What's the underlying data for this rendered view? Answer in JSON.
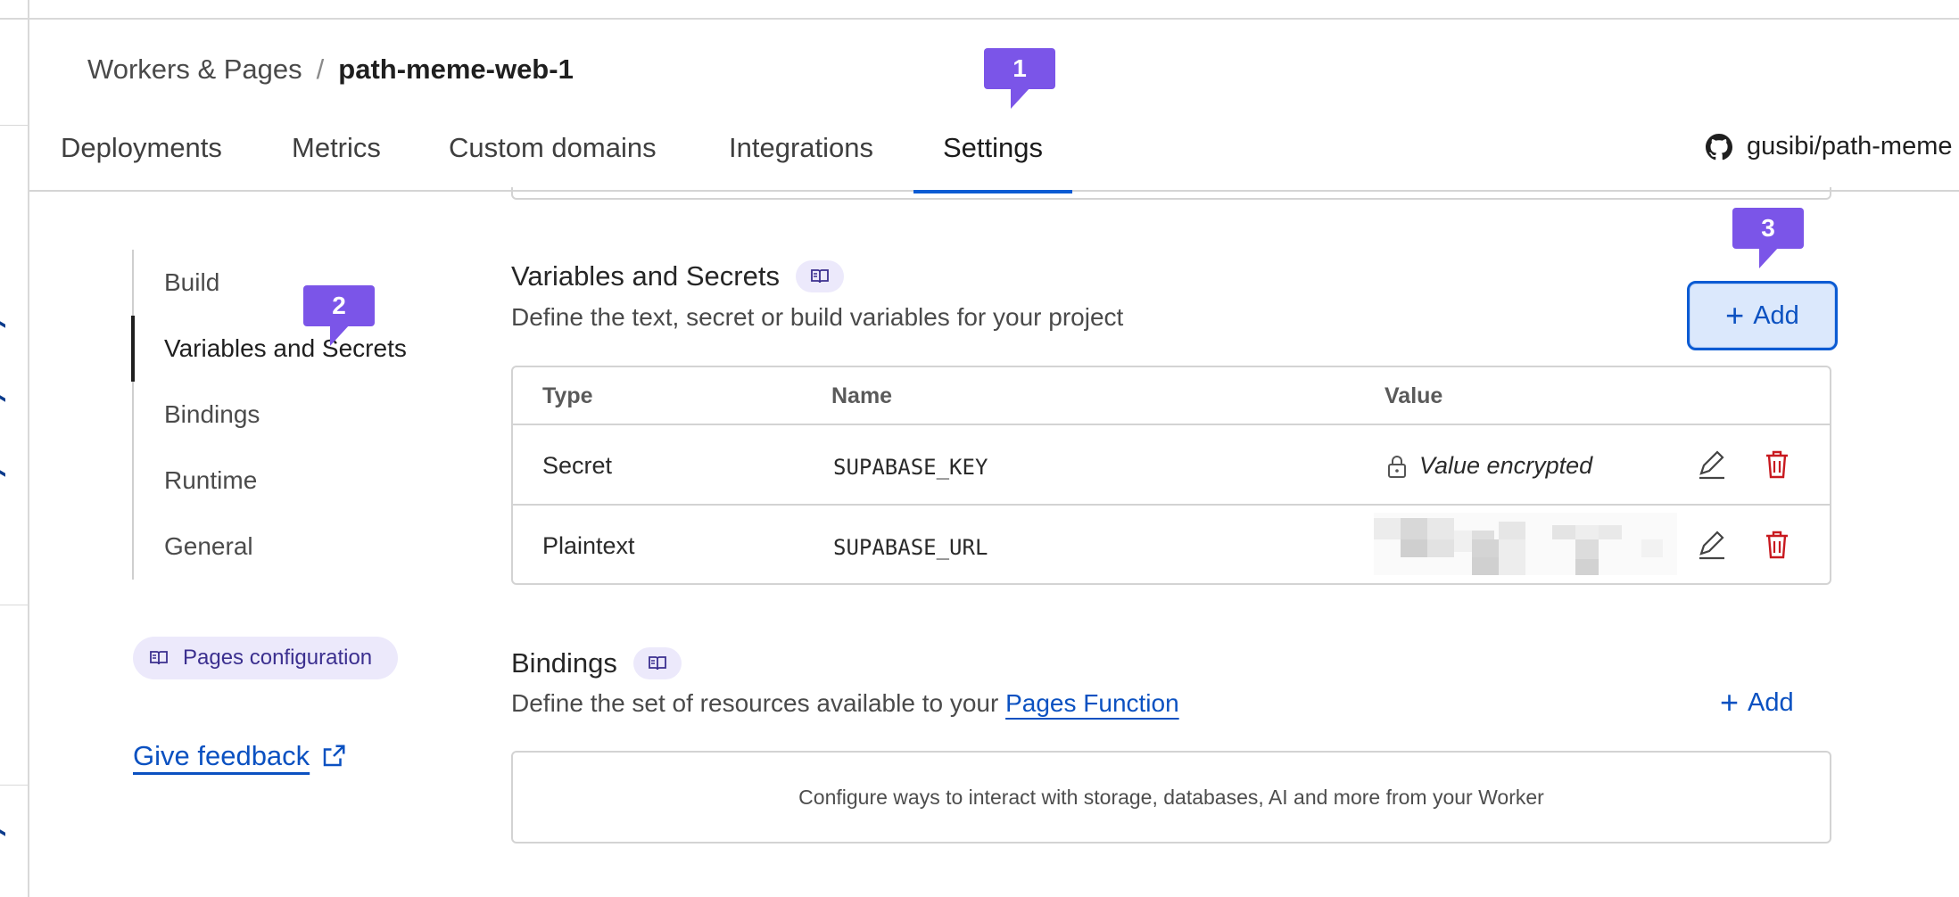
{
  "breadcrumb": {
    "parent": "Workers & Pages",
    "separator": "/",
    "current": "path-meme-web-1"
  },
  "tabs": [
    {
      "label": "Deployments"
    },
    {
      "label": "Metrics"
    },
    {
      "label": "Custom domains"
    },
    {
      "label": "Integrations"
    },
    {
      "label": "Settings",
      "active": true
    }
  ],
  "repo": {
    "label": "gusibi/path-meme",
    "icon": "github-icon"
  },
  "subnav": {
    "items": [
      {
        "label": "Build"
      },
      {
        "label": "Variables and Secrets",
        "active": true
      },
      {
        "label": "Bindings"
      },
      {
        "label": "Runtime"
      },
      {
        "label": "General"
      }
    ]
  },
  "pages_config": {
    "label": "Pages configuration"
  },
  "feedback": {
    "label": "Give feedback"
  },
  "variables": {
    "title": "Variables and Secrets",
    "description": "Define the text, secret or build variables for your project",
    "add_label": "Add",
    "columns": [
      "Type",
      "Name",
      "Value"
    ],
    "rows": [
      {
        "type": "Secret",
        "name": "SUPABASE_KEY",
        "value": "Value encrypted"
      },
      {
        "type": "Plaintext",
        "name": "SUPABASE_URL",
        "value": ""
      }
    ]
  },
  "bindings": {
    "title": "Bindings",
    "description_prefix": "Define the set of resources available to your",
    "description_link": "Pages Function",
    "add_label": "Add",
    "empty_text": "Configure ways to interact with storage, databases, AI and more from your Worker"
  },
  "callouts": [
    "1",
    "2",
    "3"
  ],
  "colors": {
    "accent": "#0b5bd3",
    "callout": "#7b55e8",
    "danger": "#c8191f",
    "pill": "#ece9fb"
  }
}
